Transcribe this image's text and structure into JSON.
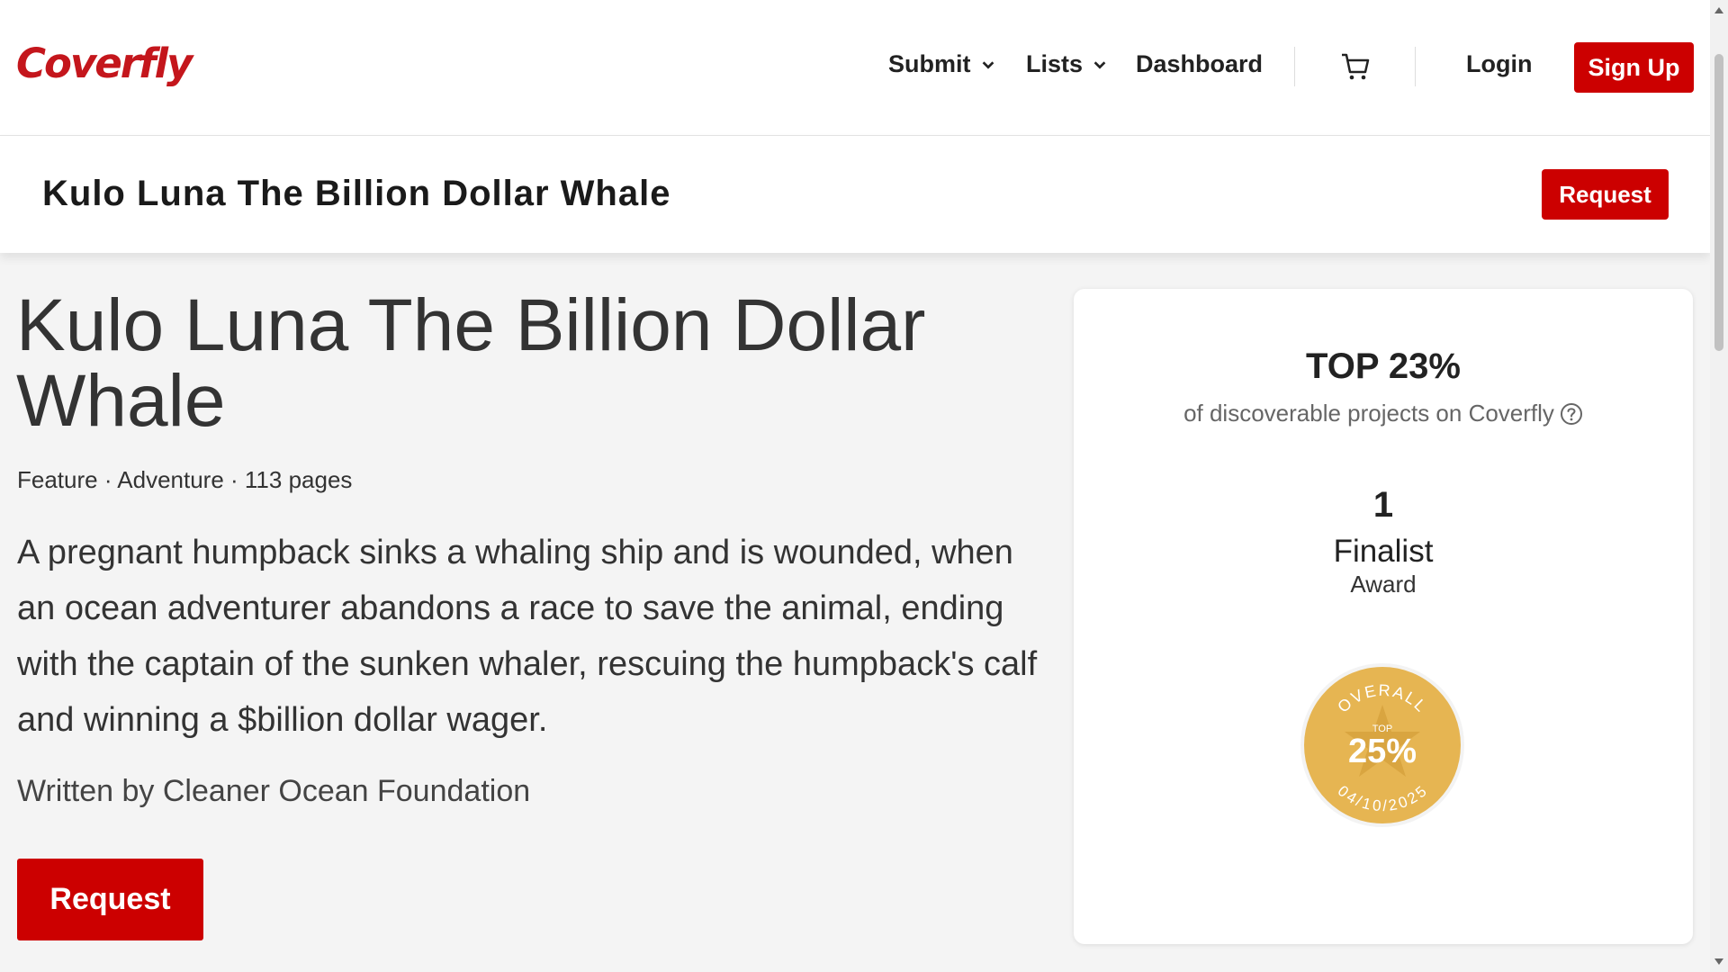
{
  "nav": {
    "logo": "Coverfly",
    "submit": "Submit",
    "lists": "Lists",
    "dashboard": "Dashboard",
    "login": "Login",
    "signup": "Sign Up"
  },
  "subheader": {
    "title": "Kulo Luna The Billion Dollar Whale",
    "request": "Request"
  },
  "project": {
    "title": "Kulo Luna The Billion Dollar Whale",
    "meta": "Feature · Adventure · 113 pages",
    "logline": "A pregnant humpback sinks a whaling ship and is wounded, when an ocean adventurer abandons a race to save the animal, ending with the captain of the sunken whaler, rescuing the humpback's calf and winning a $billion dollar wager.",
    "writer": "Written by Cleaner Ocean Foundation",
    "request": "Request"
  },
  "ranking": {
    "title": "TOP 23%",
    "subtitle": "of discoverable projects on Coverfly",
    "count": "1",
    "award_label": "Finalist",
    "award_sub": "Award",
    "badge": {
      "top_text": "OVERALL",
      "small": "TOP",
      "value": "25%",
      "date": "04/10/2025"
    }
  },
  "colors": {
    "brand": "#cc0000",
    "badge_gold": "#e6b552"
  }
}
